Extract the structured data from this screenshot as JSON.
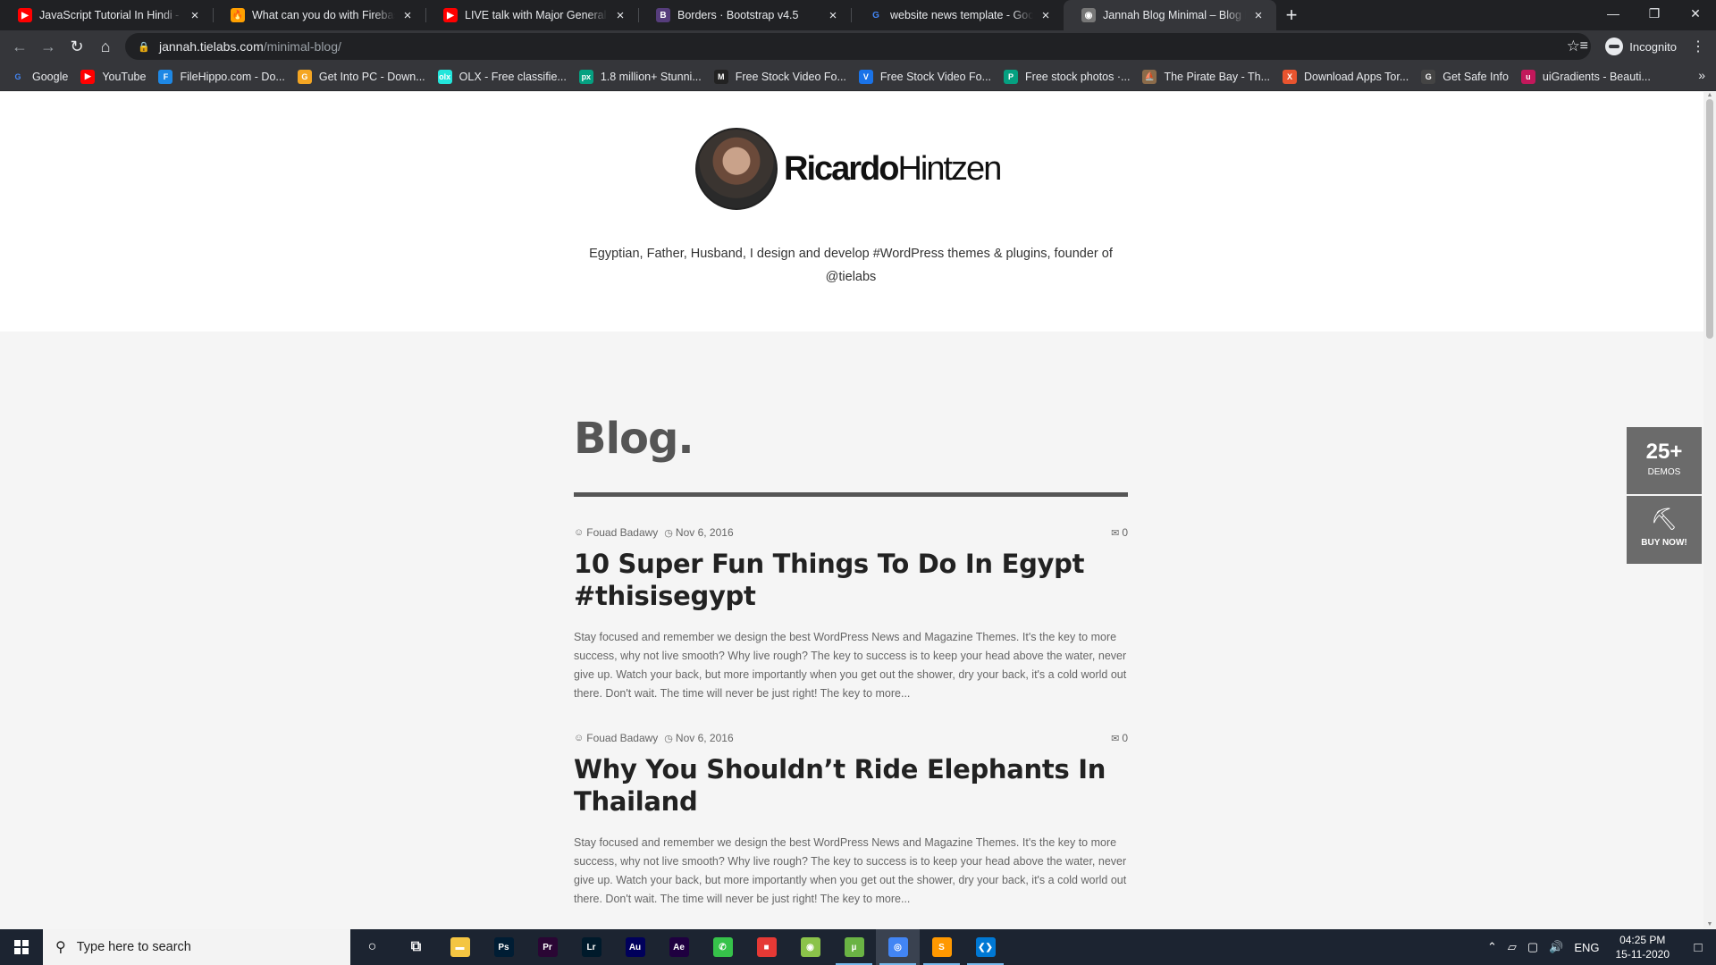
{
  "browser": {
    "tabs": [
      {
        "title": "JavaScript Tutorial In Hindi - You",
        "favicon": "youtube-icon",
        "color": "#ff0000",
        "glyph": "▶"
      },
      {
        "title": "What can you do with Firebase",
        "favicon": "firebase-icon",
        "color": "#ffa000",
        "glyph": "🔥"
      },
      {
        "title": "LIVE talk with Major General VPS",
        "favicon": "youtube-icon",
        "color": "#ff0000",
        "glyph": "▶"
      },
      {
        "title": "Borders · Bootstrap v4.5",
        "favicon": "bootstrap-icon",
        "color": "#563d7c",
        "glyph": "B"
      },
      {
        "title": "website news template - Google",
        "favicon": "google-icon",
        "color": "#ffffff",
        "glyph": "G"
      },
      {
        "title": "Jannah Blog Minimal – Blog Mag",
        "favicon": "jannah-icon",
        "color": "#777777",
        "glyph": "◉"
      }
    ],
    "new_tab": "+",
    "url_host": "jannah.tielabs.com",
    "url_path": "/minimal-blog/",
    "profile_label": "Incognito",
    "bookmarks": [
      {
        "label": "Google",
        "color": "#ffffff",
        "glyph": "G"
      },
      {
        "label": "YouTube",
        "color": "#ff0000",
        "glyph": "▶"
      },
      {
        "label": "FileHippo.com - Do...",
        "color": "#1e88e5",
        "glyph": "F"
      },
      {
        "label": "Get Into PC - Down...",
        "color": "#f5a623",
        "glyph": "G"
      },
      {
        "label": "OLX - Free classifie...",
        "color": "#23e5db",
        "glyph": "olx"
      },
      {
        "label": "1.8 million+ Stunni...",
        "color": "#05a081",
        "glyph": "px"
      },
      {
        "label": "Free Stock Video Fo...",
        "color": "#222222",
        "glyph": "M"
      },
      {
        "label": "Free Stock Video Fo...",
        "color": "#1a73e8",
        "glyph": "V"
      },
      {
        "label": "Free stock photos ·...",
        "color": "#05a081",
        "glyph": "P"
      },
      {
        "label": "The Pirate Bay - Th...",
        "color": "#8b6b4a",
        "glyph": "⛵"
      },
      {
        "label": "Download Apps Tor...",
        "color": "#e8542f",
        "glyph": "X"
      },
      {
        "label": "Get Safe Info",
        "color": "#444444",
        "glyph": "G"
      },
      {
        "label": "uiGradients - Beauti...",
        "color": "#c2185b",
        "glyph": "u"
      }
    ]
  },
  "site": {
    "logo_first": "Ricardo",
    "logo_last": "Hintzen",
    "tagline": "Egyptian, Father, Husband, I design and develop #WordPress themes & plugins, founder of @tielabs",
    "section_title": "Blog.",
    "posts": [
      {
        "author": "Fouad Badawy",
        "date": "Nov 6, 2016",
        "comments": "0",
        "title": "10 Super Fun Things To Do In Egypt #thisisegypt",
        "excerpt": "Stay focused and remember we design the best WordPress News and Magazine Themes. It's the key to more success, why not live smooth? Why live rough? The key to success is to keep your head above the water, never give up. Watch your back, but more importantly when you get out the shower, dry your back, it's a cold world out there. Don't wait. The time will never be just right! The key to more..."
      },
      {
        "author": "Fouad Badawy",
        "date": "Nov 6, 2016",
        "comments": "0",
        "title": "Why You Shouldn’t Ride Elephants In Thailand",
        "excerpt": "Stay focused and remember we design the best WordPress News and Magazine Themes. It's the key to more success, why not live smooth? Why live rough? The key to success is to keep your head above the water, never give up. Watch your back, but more importantly when you get out the shower, dry your back, it's a cold world out there. Don't wait. The time will never be just right! The key to more..."
      }
    ],
    "widget_demos_big": "25+",
    "widget_demos_small": "DEMOS",
    "widget_buy_label": "BUY NOW!"
  },
  "taskbar": {
    "search_placeholder": "Type here to search",
    "apps": [
      {
        "name": "cortana-icon",
        "glyph": "○",
        "color": "transparent"
      },
      {
        "name": "task-view-icon",
        "glyph": "⧉",
        "color": "transparent"
      },
      {
        "name": "file-explorer-icon",
        "glyph": "▬",
        "color": "#f4c542"
      },
      {
        "name": "photoshop-icon",
        "glyph": "Ps",
        "color": "#001d34"
      },
      {
        "name": "premiere-icon",
        "glyph": "Pr",
        "color": "#2a0634"
      },
      {
        "name": "lightroom-icon",
        "glyph": "Lr",
        "color": "#001a2b"
      },
      {
        "name": "audition-icon",
        "glyph": "Au",
        "color": "#00005b"
      },
      {
        "name": "after-effects-icon",
        "glyph": "Ae",
        "color": "#1f0040"
      },
      {
        "name": "phone-icon",
        "glyph": "✆",
        "color": "#36c24a"
      },
      {
        "name": "screen-recorder-icon",
        "glyph": "■",
        "color": "#e53935"
      },
      {
        "name": "android-icon",
        "glyph": "◉",
        "color": "#8bc34a"
      },
      {
        "name": "utorrent-icon",
        "glyph": "µ",
        "color": "#6ab344"
      },
      {
        "name": "chrome-icon",
        "glyph": "◎",
        "color": "#4285f4"
      },
      {
        "name": "sublime-icon",
        "glyph": "S",
        "color": "#ff9800"
      },
      {
        "name": "vscode-icon",
        "glyph": "❮❯",
        "color": "#0078d4"
      }
    ],
    "language": "ENG",
    "time": "04:25 PM",
    "date": "15-11-2020"
  }
}
